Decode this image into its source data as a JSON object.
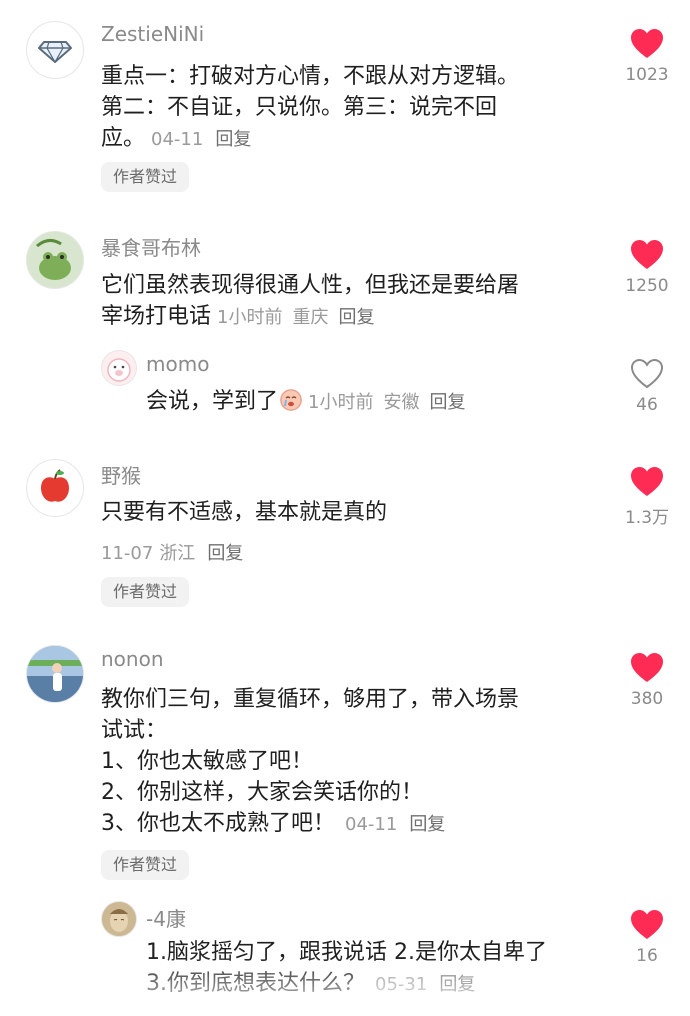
{
  "colors": {
    "like_red": "#fe2c55",
    "text": "#1f1f1f",
    "meta": "#9a9a9a"
  },
  "comments": [
    {
      "user": "ZestieNiNi",
      "avatar_icon": "diamond-icon",
      "lines": [
        "重点一：打破对方心情，不跟从对方逻辑。",
        "第二：不自证，只说你。第三：说完不回",
        "应。"
      ],
      "date": "04-11",
      "reply": "回复",
      "badge": "作者赞过",
      "likes": "1023",
      "liked": true
    },
    {
      "user": "暴食哥布林",
      "avatar_icon": "frog-icon",
      "lines": [
        "它们虽然表现得很通人性，但我还是要给屠",
        "宰场打电话"
      ],
      "time": "1小时前",
      "location": "重庆",
      "reply": "回复",
      "likes": "1250",
      "liked": true,
      "replies": [
        {
          "user": "momo",
          "avatar_icon": "pig-icon",
          "text": "会说，学到了",
          "emoji": "crying-face-icon",
          "time": "1小时前",
          "location": "安徽",
          "reply": "回复",
          "likes": "46",
          "liked": false
        }
      ]
    },
    {
      "user": "野猴",
      "avatar_icon": "apple-icon",
      "lines": [
        "只要有不适感，基本就是真的"
      ],
      "date": "11-07",
      "location": "浙江",
      "reply": "回复",
      "badge": "作者赞过",
      "likes": "1.3万",
      "liked": true
    },
    {
      "user": "nonon",
      "avatar_icon": "photo-avatar-icon",
      "lines": [
        "教你们三句，重复循环，够用了，带入场景",
        "试试：",
        "1、你也太敏感了吧！",
        "2、你别这样，大家会笑话你的！",
        "3、你也太不成熟了吧！"
      ],
      "date": "04-11",
      "reply": "回复",
      "badge": "作者赞过",
      "likes": "380",
      "liked": true,
      "replies": [
        {
          "user": "-4康",
          "avatar_icon": "buddha-statue-icon",
          "lines": [
            "1.脑浆摇匀了，跟我说话 2.是你太自卑了",
            "3.你到底想表达什么？"
          ],
          "date": "05-31",
          "reply": "回复",
          "likes": "16",
          "liked": true
        }
      ]
    }
  ]
}
